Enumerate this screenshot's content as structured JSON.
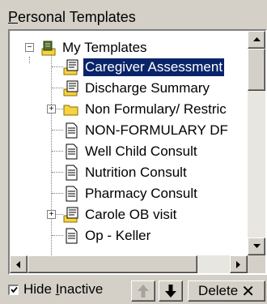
{
  "panel": {
    "title_first": "P",
    "title_rest": "ersonal Templates"
  },
  "tree": {
    "root": {
      "label": "My Templates",
      "icon": "template-folder-icon"
    },
    "items": [
      {
        "label": "Caregiver Assessment",
        "icon": "template-doc-icon",
        "selected": true
      },
      {
        "label": "Discharge Summary",
        "icon": "template-doc-icon"
      },
      {
        "label": "Non Formulary/ Restric",
        "icon": "folder-icon",
        "expandable": true
      },
      {
        "label": "NON-FORMULARY DF",
        "icon": "document-icon"
      },
      {
        "label": "Well Child Consult",
        "icon": "document-icon"
      },
      {
        "label": "Nutrition Consult",
        "icon": "document-icon"
      },
      {
        "label": "Pharmacy Consult",
        "icon": "document-icon"
      },
      {
        "label": "Carole OB visit",
        "icon": "template-folder-icon",
        "expandable": true
      },
      {
        "label": "Op - Keller",
        "icon": "document-icon"
      }
    ]
  },
  "toolbar": {
    "hide_inactive_pre": "Hide ",
    "hide_inactive_ul": "I",
    "hide_inactive_post": "nactive",
    "hide_inactive_checked": true,
    "delete_label": "Delete",
    "delete_symbol": "✕"
  },
  "colors": {
    "selection": "#0a246a",
    "window_face": "#d4d0c8",
    "folder": "#f5d341"
  }
}
